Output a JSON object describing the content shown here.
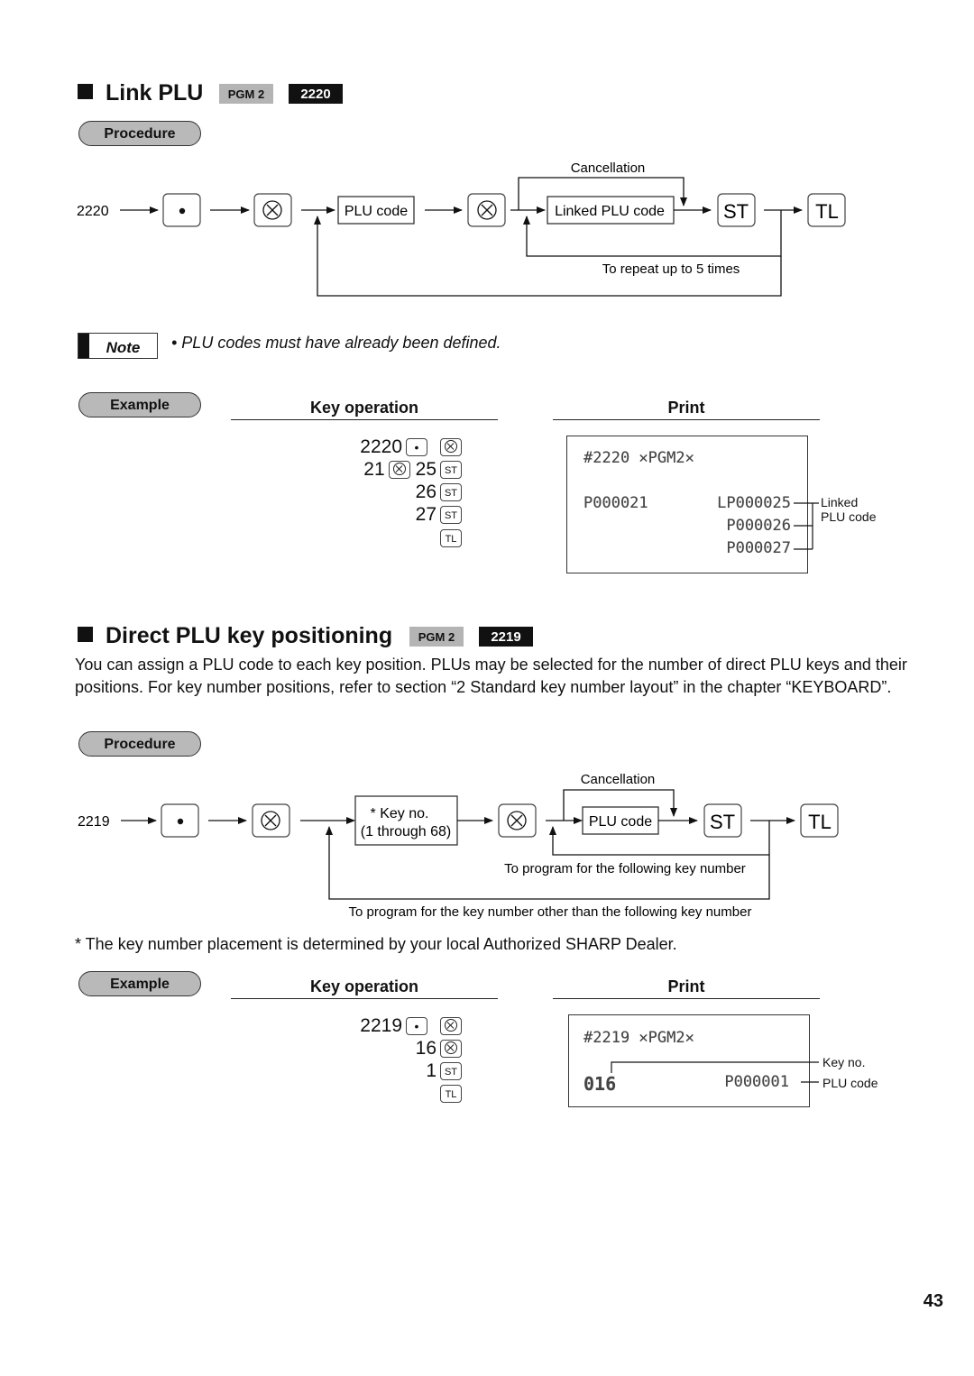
{
  "page_number": "43",
  "link_plu": {
    "title": "Link PLU",
    "mode_badge": "PGM 2",
    "job_code": "2220",
    "procedure_label": "Procedure",
    "diagram": {
      "start_code": "2220",
      "dot_key": "•",
      "plu_code_box": "PLU code",
      "linked_plu_box": "Linked PLU code",
      "st_key": "ST",
      "tl_key": "TL",
      "cancellation_label": "Cancellation",
      "repeat_label": "To repeat up to 5 times"
    },
    "note_label": "Note",
    "note_text": "• PLU codes must have already been defined.",
    "example_label": "Example",
    "key_operation_header": "Key operation",
    "print_header": "Print",
    "key_ops": [
      {
        "value": "2220",
        "keys": [
          "•",
          "⊗"
        ]
      },
      {
        "value": "21",
        "mid_key": "⊗",
        "value2": "25",
        "keys": [
          "ST"
        ]
      },
      {
        "value": "26",
        "keys": [
          "ST"
        ]
      },
      {
        "value": "27",
        "keys": [
          "ST"
        ]
      },
      {
        "value": "",
        "keys": [
          "TL"
        ]
      }
    ],
    "receipt": {
      "header": "#2220 ✕PGM2✕",
      "plu": "P000021",
      "linked": [
        "LP000025",
        "P000026",
        "P000027"
      ]
    },
    "receipt_annotation": "Linked\nPLU code",
    "receipt_annotation_line1": "Linked",
    "receipt_annotation_line2": "PLU code"
  },
  "direct_plu": {
    "title": "Direct PLU key positioning",
    "mode_badge": "PGM 2",
    "job_code": "2219",
    "description": "You can assign a PLU code to each key position.  PLUs may be selected for the number of direct PLU keys and their positions.  For key number positions, refer to section “2 Standard key number layout” in the chapter “KEYBOARD”.",
    "procedure_label": "Procedure",
    "diagram": {
      "start_code": "2219",
      "dot_key": "•",
      "key_no_box_line1": "* Key no.",
      "key_no_box_line2": "(1 through 68)",
      "plu_code_box": "PLU code",
      "st_key": "ST",
      "tl_key": "TL",
      "cancellation_label": "Cancellation",
      "following_label": "To program for the following key number",
      "other_label": "To program for the key number other than the following key number"
    },
    "footnote": "* The key number placement is determined by your local Authorized SHARP Dealer.",
    "example_label": "Example",
    "key_operation_header": "Key operation",
    "print_header": "Print",
    "key_ops": [
      {
        "value": "2219",
        "keys": [
          "•",
          "⊗"
        ]
      },
      {
        "value": "16",
        "keys": [
          "⊗"
        ]
      },
      {
        "value": "1",
        "keys": [
          "ST"
        ]
      },
      {
        "value": "",
        "keys": [
          "TL"
        ]
      }
    ],
    "receipt": {
      "header": "#2219 ✕PGM2✕",
      "key_no": "016",
      "plu": "P000001"
    },
    "annotation_key_no": "Key no.",
    "annotation_plu_code": "PLU code"
  }
}
